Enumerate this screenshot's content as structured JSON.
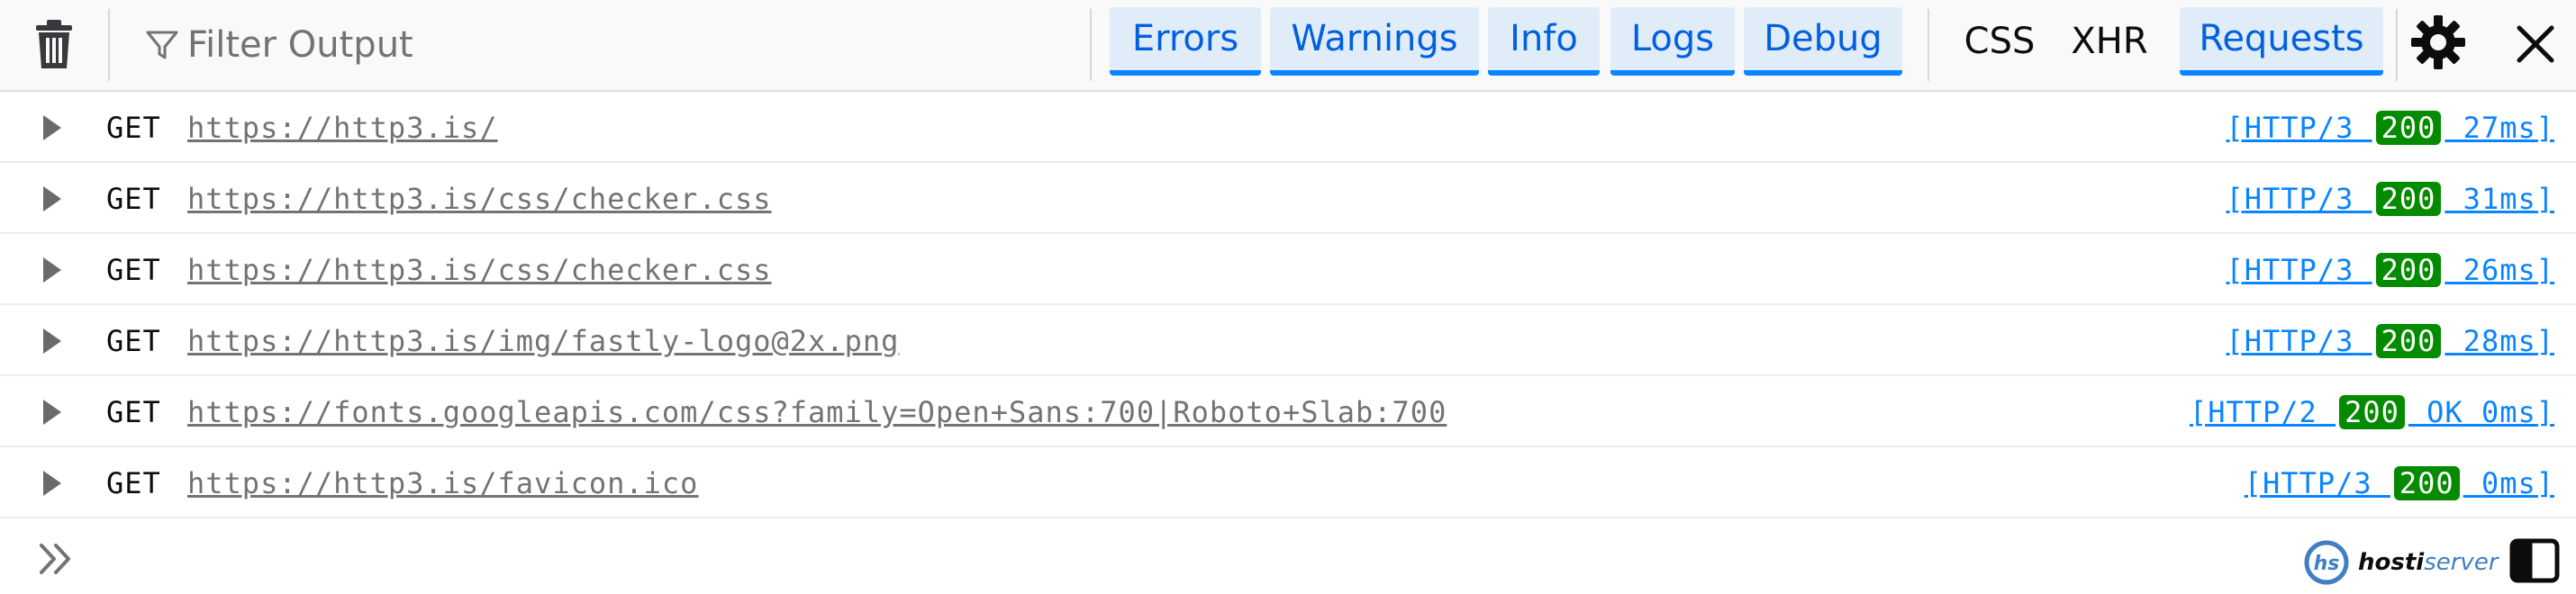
{
  "toolbar": {
    "filter_placeholder": "Filter Output",
    "level_filters": [
      {
        "label": "Errors",
        "active": true
      },
      {
        "label": "Warnings",
        "active": true
      },
      {
        "label": "Info",
        "active": true
      },
      {
        "label": "Logs",
        "active": true
      },
      {
        "label": "Debug",
        "active": true
      }
    ],
    "type_filters": [
      {
        "label": "CSS",
        "active": false
      },
      {
        "label": "XHR",
        "active": false
      },
      {
        "label": "Requests",
        "active": true
      }
    ]
  },
  "requests": [
    {
      "method": "GET",
      "url": "https://http3.is/",
      "protocol": "HTTP/3",
      "status": "200",
      "status_text": "",
      "time": "27ms"
    },
    {
      "method": "GET",
      "url": "https://http3.is/css/checker.css",
      "protocol": "HTTP/3",
      "status": "200",
      "status_text": "",
      "time": "31ms"
    },
    {
      "method": "GET",
      "url": "https://http3.is/css/checker.css",
      "protocol": "HTTP/3",
      "status": "200",
      "status_text": "",
      "time": "26ms"
    },
    {
      "method": "GET",
      "url": "https://http3.is/img/fastly-logo@2x.png",
      "protocol": "HTTP/3",
      "status": "200",
      "status_text": "",
      "time": "28ms"
    },
    {
      "method": "GET",
      "url": "https://fonts.googleapis.com/css?family=Open+Sans:700|Roboto+Slab:700",
      "protocol": "HTTP/2",
      "status": "200",
      "status_text": "OK",
      "time": "0ms"
    },
    {
      "method": "GET",
      "url": "https://http3.is/favicon.ico",
      "protocol": "HTTP/3",
      "status": "200",
      "status_text": "",
      "time": "0ms"
    }
  ],
  "watermark": {
    "bold": "hosti",
    "light": "server",
    "logo_letters": "hs"
  },
  "colors": {
    "accent": "#0a84ff",
    "status_ok": "#058b00",
    "link": "#737373"
  },
  "icons": {
    "clear": "trash-icon",
    "filter": "filter-icon",
    "settings": "gear-icon",
    "close": "close-icon",
    "expand": "triangle-right-icon",
    "prompt": "double-chevron-right-icon",
    "split": "split-panel-icon"
  }
}
